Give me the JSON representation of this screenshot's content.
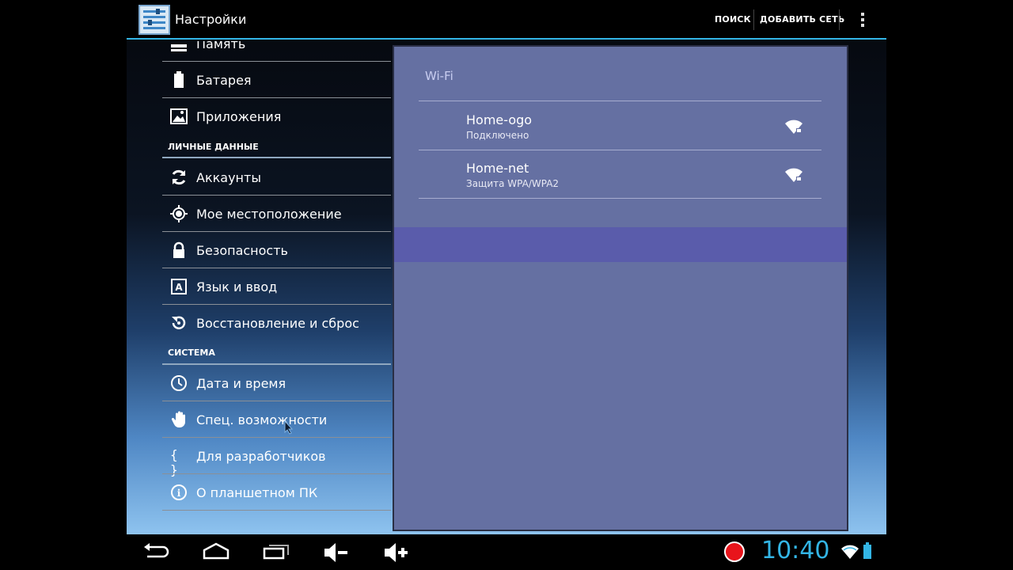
{
  "actionbar": {
    "title": "Настройки",
    "search_label": "ПОИСК",
    "add_network_label": "ДОБАВИТЬ СЕТЬ"
  },
  "sidebar": {
    "items_top": [
      {
        "label": "Память",
        "icon": "storage-icon"
      },
      {
        "label": "Батарея",
        "icon": "battery-icon"
      },
      {
        "label": "Приложения",
        "icon": "apps-icon"
      }
    ],
    "section_personal": "ЛИЧНЫЕ ДАННЫЕ",
    "items_personal": [
      {
        "label": "Аккаунты",
        "icon": "sync-icon"
      },
      {
        "label": "Мое местоположение",
        "icon": "location-icon"
      },
      {
        "label": "Безопасность",
        "icon": "lock-icon"
      },
      {
        "label": "Язык и ввод",
        "icon": "language-icon"
      },
      {
        "label": "Восстановление и сброс",
        "icon": "backup-icon"
      }
    ],
    "section_system": "СИСТЕМА",
    "items_system": [
      {
        "label": "Дата и время",
        "icon": "clock-icon"
      },
      {
        "label": "Спец. возможности",
        "icon": "hand-icon"
      },
      {
        "label": "Для разработчиков",
        "icon": "braces-icon"
      },
      {
        "label": "О планшетном ПК",
        "icon": "info-icon"
      }
    ],
    "braces_glyph": "{ }",
    "language_glyph": "A",
    "info_glyph": "i"
  },
  "detail": {
    "header": "Wi-Fi",
    "networks": [
      {
        "name": "Home-ogo",
        "status": "Подключено"
      },
      {
        "name": "Home-net",
        "status": "Защита WPA/WPA2"
      }
    ]
  },
  "statusbar": {
    "time": "10:40"
  },
  "colors": {
    "accent": "#33b5e5",
    "detail_bg": "#6570a2",
    "record": "#e8141b"
  }
}
